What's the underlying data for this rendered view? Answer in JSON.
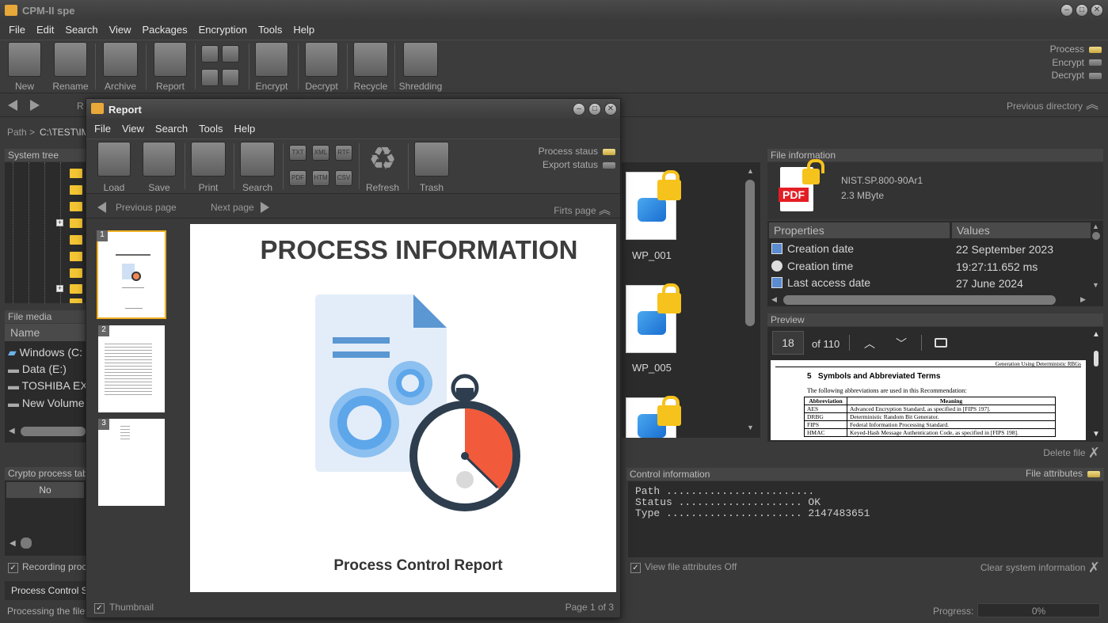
{
  "app": {
    "title": "CPM-II spe"
  },
  "menu": [
    "File",
    "Edit",
    "Search",
    "View",
    "Packages",
    "Encryption",
    "Tools",
    "Help"
  ],
  "toolbar": [
    {
      "label": "New",
      "icon": "new-icon"
    },
    {
      "label": "Rename",
      "icon": "rename-icon"
    },
    {
      "label": "Archive",
      "icon": "archive-icon"
    },
    {
      "label": "Report",
      "icon": "report-icon"
    },
    {
      "label": "",
      "icon": "batch-icons"
    },
    {
      "label": "Encrypt",
      "icon": "lock-icon"
    },
    {
      "label": "Decrypt",
      "icon": "key-icon"
    },
    {
      "label": "Recycle",
      "icon": "recycle-icon"
    },
    {
      "label": "Shredding",
      "icon": "shredder-icon"
    }
  ],
  "indicators": {
    "process": "Process",
    "encrypt": "Encrypt",
    "decrypt": "Decrypt"
  },
  "nav": {
    "prev_dir": "Previous directory",
    "path_label": "Path >",
    "path_value": "C:\\TEST\\IM",
    "r_label": "R"
  },
  "panels": {
    "system_tree": "System tree",
    "file_media": "File media",
    "name_col": "Name",
    "crypto_tab": "Crypto process tab",
    "no_col": "No",
    "recording": "Recording proc",
    "process_control": "Process Control Sh",
    "processing": "Processing the files"
  },
  "drives": [
    {
      "label": "Windows  (C:"
    },
    {
      "label": "Data (E:)"
    },
    {
      "label": "TOSHIBA EXT"
    },
    {
      "label": "New Volume"
    }
  ],
  "files": [
    {
      "name": "WP_001"
    },
    {
      "name": "WP_005"
    }
  ],
  "file_info": {
    "header": "File information",
    "file_name": "NIST.SP.800-90Ar1",
    "file_size": "2.3 MByte",
    "pdf_badge": "PDF",
    "col_properties": "Properties",
    "col_values": "Values",
    "rows": [
      {
        "prop": "Creation date",
        "value": "22 September 2023"
      },
      {
        "prop": "Creation time",
        "value": "19:27:11.652 ms"
      },
      {
        "prop": "Last access date",
        "value": "27 June 2024"
      }
    ]
  },
  "preview": {
    "header": "Preview",
    "page_value": "18",
    "of_label": "of 110",
    "doc_header": "Generation Using Deterministic RBGs",
    "section": "5   Symbols and Abbreviated Terms",
    "intro": "The following abbreviations are used in this Recommendation:",
    "table_head": [
      "Abbreviation",
      "Meaning"
    ],
    "table_rows": [
      [
        "AES",
        "Advanced Encryption Standard, as specified in [FIPS 197]."
      ],
      [
        "DRBG",
        "Deterministic Random Bit Generator."
      ],
      [
        "FIPS",
        "Federal Information Processing Standard."
      ],
      [
        "HMAC",
        "Keyed-Hash Message Authentication Code, as specified in [FIPS 198]."
      ]
    ],
    "delete_file": "Delete file"
  },
  "control": {
    "header": "Control information",
    "attrs": "File attributes",
    "lines": [
      "Path ........................",
      "Status .................... OK",
      "Type ...................... 2147483651"
    ],
    "view_attrs": "View file attributes Off",
    "clear": "Clear system information"
  },
  "statusbar": {
    "progress_label": "Progress:",
    "progress_value": "0%",
    "progress": 0
  },
  "report": {
    "title": "Report",
    "menu": [
      "File",
      "View",
      "Search",
      "Tools",
      "Help"
    ],
    "toolbar": [
      {
        "label": "Load"
      },
      {
        "label": "Save"
      },
      {
        "label": "Print"
      },
      {
        "label": "Search"
      },
      {
        "label": ""
      },
      {
        "label": "Refresh"
      },
      {
        "label": "Trash"
      }
    ],
    "format_icons": [
      "TXT",
      "XML",
      "RTF",
      "PDF",
      "HTM",
      "CSV"
    ],
    "process_status": "Process staus",
    "export_status": "Export status",
    "prev_page": "Previous page",
    "next_page": "Next page",
    "first_page": "Firts page",
    "thumbs": [
      "1",
      "2",
      "3"
    ],
    "page_title": "PROCESS INFORMATION",
    "page_caption": "Process Control Report",
    "thumbnail_label": "Thumbnail",
    "page_info": "Page 1 of 3"
  }
}
